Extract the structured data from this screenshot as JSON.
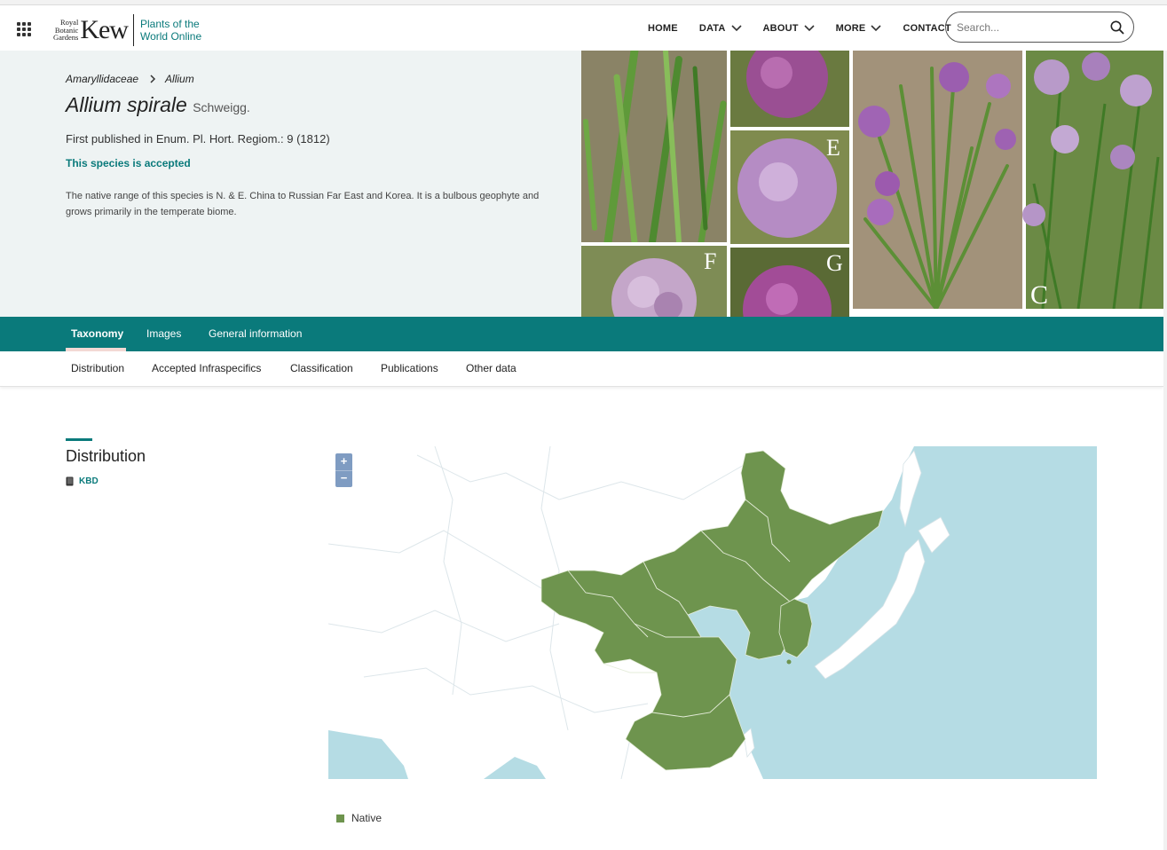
{
  "header": {
    "logo_small": [
      "Royal",
      "Botanic",
      "Gardens"
    ],
    "logo_kew": "Kew",
    "logo_powo_line1": "Plants of the",
    "logo_powo_line2": "World Online",
    "nav": [
      {
        "label": "HOME",
        "dropdown": false
      },
      {
        "label": "DATA",
        "dropdown": true
      },
      {
        "label": "ABOUT",
        "dropdown": true
      },
      {
        "label": "MORE",
        "dropdown": true
      },
      {
        "label": "CONTACT",
        "dropdown": false
      }
    ],
    "search": {
      "placeholder": "Search..."
    }
  },
  "hero": {
    "breadcrumb": [
      "Amaryllidaceae",
      "Allium"
    ],
    "species_name": "Allium spirale",
    "author": "Schweigg.",
    "published": "First published in Enum. Pl. Hort. Regiom.: 9 (1812)",
    "status": "This species is accepted",
    "native_range": "The native range of this species is N. & E. China to Russian Far East and Korea. It is a bulbous geophyte and grows primarily in the temperate biome.",
    "image_panel_letters": [
      "E",
      "F",
      "G",
      "C"
    ]
  },
  "tabs": [
    {
      "label": "Taxonomy",
      "active": true
    },
    {
      "label": "Images",
      "active": false
    },
    {
      "label": "General information",
      "active": false
    }
  ],
  "subnav": [
    "Distribution",
    "Accepted Infraspecifics",
    "Classification",
    "Publications",
    "Other data"
  ],
  "distribution": {
    "title": "Distribution",
    "source_link": "KBD",
    "zoom_in": "+",
    "zoom_out": "−",
    "legend": [
      {
        "label": "Native",
        "color": "#6e944e"
      }
    ]
  },
  "colors": {
    "accent": "#0a7a7b",
    "hero_bg": "#eef3f3",
    "native": "#6e944e",
    "sea": "#b5dce4",
    "zoom_control": "#7f9cc2"
  },
  "icons": [
    "apps-grid-icon",
    "chevron-right-icon",
    "chevron-down-icon",
    "search-icon",
    "book-icon"
  ]
}
